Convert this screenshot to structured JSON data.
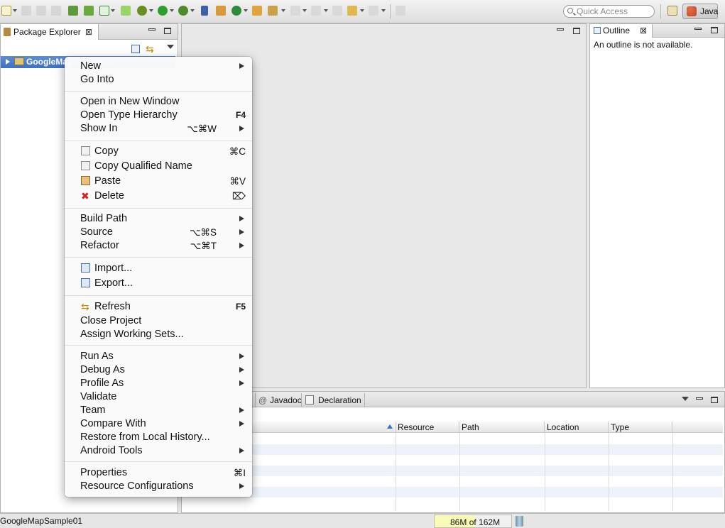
{
  "toolbar": {
    "quick_access_placeholder": "Quick Access",
    "perspective_label": "Java"
  },
  "package_explorer": {
    "tab_label": "Package Explorer",
    "project_name": "GoogleMapSample01"
  },
  "outline": {
    "tab_label": "Outline",
    "message": "An outline is not available."
  },
  "bottom_panel": {
    "tabs": [
      "Javadoc",
      "Declaration"
    ],
    "columns": [
      "Resource",
      "Path",
      "Location",
      "Type"
    ]
  },
  "status_bar": {
    "selection": "GoogleMapSample01",
    "heap_used": "86M",
    "heap_of": "of",
    "heap_total": "162M",
    "heap_used_fraction": 0.53
  },
  "context_menu": {
    "items": [
      {
        "label": "New",
        "submenu": true
      },
      {
        "label": "Go Into"
      },
      {
        "label": "Open in New Window"
      },
      {
        "label": "Open Type Hierarchy",
        "shortcut": "F4"
      },
      {
        "label": "Show In",
        "shortcut": "⌥⌘W",
        "submenu": true
      },
      {
        "label": "Copy",
        "shortcut": "⌘C",
        "icon": "copy-icon"
      },
      {
        "label": "Copy Qualified Name",
        "icon": "copy-qualified-name-icon"
      },
      {
        "label": "Paste",
        "shortcut": "⌘V",
        "icon": "paste-icon"
      },
      {
        "label": "Delete",
        "shortcut": "⌦",
        "icon": "delete-icon"
      },
      {
        "label": "Build Path",
        "submenu": true
      },
      {
        "label": "Source",
        "shortcut": "⌥⌘S",
        "submenu": true
      },
      {
        "label": "Refactor",
        "shortcut": "⌥⌘T",
        "submenu": true
      },
      {
        "label": "Import...",
        "icon": "import-icon"
      },
      {
        "label": "Export...",
        "icon": "export-icon"
      },
      {
        "label": "Refresh",
        "shortcut": "F5",
        "icon": "refresh-icon"
      },
      {
        "label": "Close Project"
      },
      {
        "label": "Assign Working Sets..."
      },
      {
        "label": "Run As",
        "submenu": true
      },
      {
        "label": "Debug As",
        "submenu": true
      },
      {
        "label": "Profile As",
        "submenu": true
      },
      {
        "label": "Validate"
      },
      {
        "label": "Team",
        "submenu": true
      },
      {
        "label": "Compare With",
        "submenu": true
      },
      {
        "label": "Restore from Local History..."
      },
      {
        "label": "Android Tools",
        "submenu": true
      },
      {
        "label": "Properties",
        "shortcut": "⌘I"
      },
      {
        "label": "Resource Configurations",
        "submenu": true
      }
    ]
  }
}
